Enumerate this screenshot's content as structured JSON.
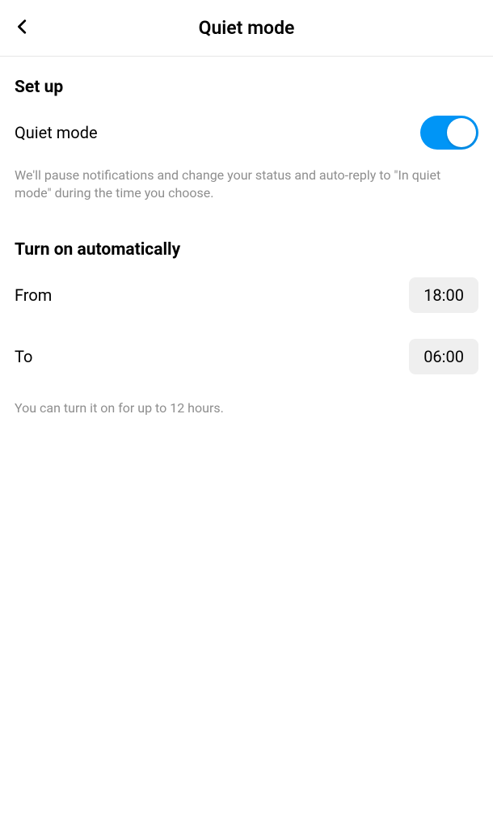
{
  "header": {
    "title": "Quiet mode"
  },
  "sections": {
    "setup": {
      "title": "Set up",
      "toggle_label": "Quiet mode",
      "description": "We'll pause notifications and change your status and auto-reply to \"In quiet mode\" during the time you choose."
    },
    "auto": {
      "title": "Turn on automatically",
      "from_label": "From",
      "from_value": "18:00",
      "to_label": "To",
      "to_value": "06:00",
      "note": "You can turn it on for up to 12 hours."
    }
  },
  "toggle_on": true,
  "colors": {
    "accent": "#0095f6"
  }
}
